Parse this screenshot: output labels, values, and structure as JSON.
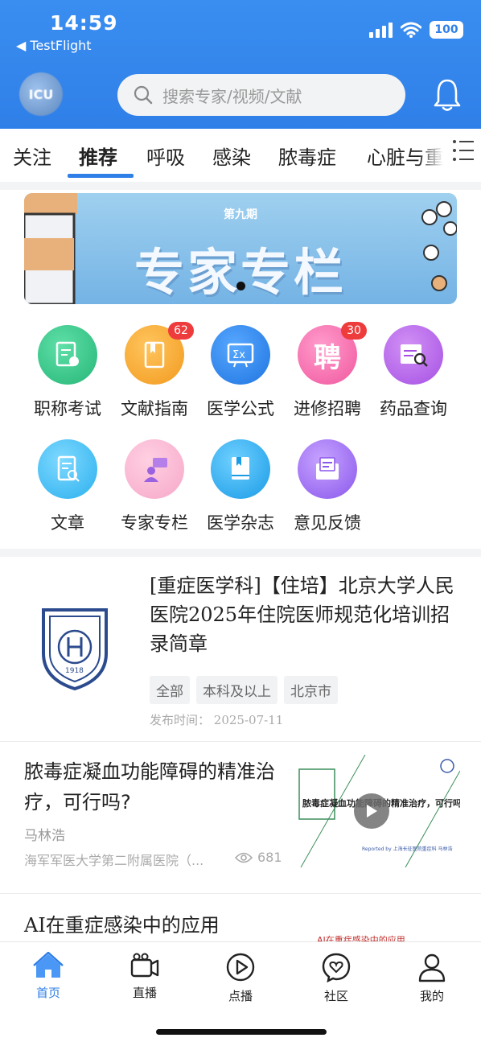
{
  "status_bar": {
    "time": "14:59",
    "back_app": "TestFlight",
    "battery": "100"
  },
  "header": {
    "avatar_text": "ICU",
    "search_placeholder": "搜索专家/视频/文献"
  },
  "tabs": [
    {
      "label": "关注"
    },
    {
      "label": "推荐",
      "active": true
    },
    {
      "label": "呼吸"
    },
    {
      "label": "感染"
    },
    {
      "label": "脓毒症"
    },
    {
      "label": "心脏与重"
    }
  ],
  "banner": {
    "issue": "第九期",
    "title": "专家专栏"
  },
  "grid": [
    {
      "label": "职称考试",
      "icon": "exam-icon",
      "color": "#36c98a"
    },
    {
      "label": "文献指南",
      "icon": "book-icon",
      "color": "#f7a531",
      "badge": "62"
    },
    {
      "label": "医学公式",
      "icon": "formula-icon",
      "color": "#2f8ff0"
    },
    {
      "label": "进修招聘",
      "icon": "recruit-icon",
      "color": "#f46fae",
      "badge": "30"
    },
    {
      "label": "药品查询",
      "icon": "drug-search-icon",
      "color": "#b66ae6"
    },
    {
      "label": "文章",
      "icon": "article-icon",
      "color": "#4cc1f0"
    },
    {
      "label": "专家专栏",
      "icon": "expert-icon",
      "color": "#f7a3c5"
    },
    {
      "label": "医学杂志",
      "icon": "journal-icon",
      "color": "#2aa9ef"
    },
    {
      "label": "意见反馈",
      "icon": "feedback-icon",
      "color": "#9b6cf0"
    }
  ],
  "job": {
    "title": "[重症医学科]【住培】北京大学人民医院2025年住院医师规范化培训招录简章",
    "tags": [
      "全部",
      "本科及以上",
      "北京市"
    ],
    "date_label": "发布时间：",
    "date": "2025-07-11",
    "logo_year": "1918"
  },
  "article1": {
    "title": "脓毒症凝血功能障碍的精准治疗，可行吗?",
    "author": "马林浩",
    "institution": "海军军医大学第二附属医院（...",
    "views": "681",
    "thumb_title": "脓毒症凝血功能障碍的精准治疗，可行吗?",
    "thumb_credit": "Reported by  上海长征医院重症科 马林浩"
  },
  "article2": {
    "title": "AI在重症感染中的应用",
    "thumb_peek": "AI在重症感染中的应用"
  },
  "bottom_nav": [
    {
      "label": "首页",
      "active": true
    },
    {
      "label": "直播"
    },
    {
      "label": "点播"
    },
    {
      "label": "社区"
    },
    {
      "label": "我的"
    }
  ],
  "colors": {
    "primary": "#2f7fe8",
    "badge": "#ee3b3b"
  }
}
